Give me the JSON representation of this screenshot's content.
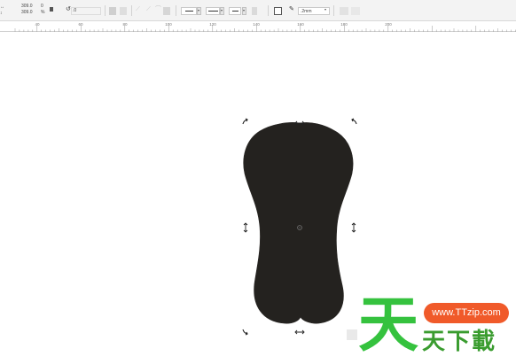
{
  "property_bar": {
    "width_value": "309.0",
    "height_value": "309.0",
    "scale_x": "0",
    "scale_y": "%",
    "rotation_value": ".0",
    "outline_width": ".2mm"
  },
  "ruler": {
    "labels": [
      "40",
      "60",
      "80",
      "100",
      "120",
      "140",
      "160",
      "180",
      "200"
    ]
  },
  "shape": {
    "fill_color": "#24221f",
    "name": "bone-shape"
  },
  "watermark": {
    "url": "www.TTzip.com",
    "big_char": "天",
    "chars": "天下載",
    "url_color": "#f05a2a",
    "char_color": "#35c23e"
  }
}
